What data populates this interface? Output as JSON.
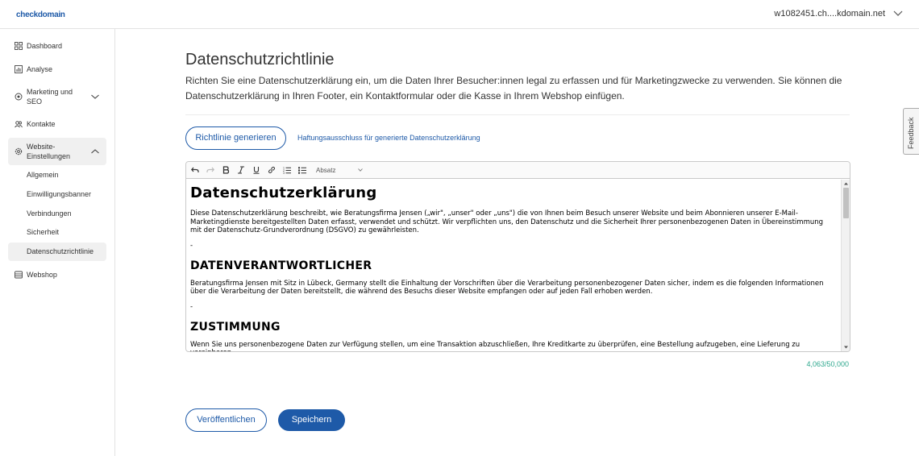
{
  "header": {
    "logo": "checkdomain",
    "account": "w1082451.ch....kdomain.net"
  },
  "sidebar": {
    "items": [
      {
        "label": "Dashboard",
        "icon": "grid-icon"
      },
      {
        "label": "Analyse",
        "icon": "bar-chart-icon"
      },
      {
        "label": "Marketing und SEO",
        "icon": "target-icon"
      },
      {
        "label": "Kontakte",
        "icon": "users-icon"
      },
      {
        "label": "Website-Einstellungen",
        "icon": "gear-icon"
      },
      {
        "label": "Webshop",
        "icon": "store-icon"
      }
    ],
    "marketing_line1": "Marketing und",
    "marketing_line2": "SEO",
    "website_line1": "Website-",
    "website_line2": "Einstellungen",
    "subitems": [
      "Allgemein",
      "Einwilligungsbanner",
      "Verbindungen",
      "Sicherheit",
      "Datenschutzrichtlinie"
    ]
  },
  "main": {
    "title": "Datenschutzrichtlinie",
    "description": "Richten Sie eine Datenschutzerklärung ein, um die Daten Ihrer Besucher:innen legal zu erfassen und für Marketingzwecke zu verwenden. Sie können die Datenschutzerklärung in Ihren Footer, ein Kontaktformular oder die Kasse in Ihrem Webshop einfügen.",
    "generate_button": "Richtlinie generieren",
    "disclaimer_link": "Haftungsausschluss für generierte Datenschutzerklärung",
    "editor": {
      "format_select": "Absatz",
      "heading1": "Datenschutzerklärung",
      "para1": "Diese Datenschutzerklärung beschreibt, wie Beratungsfirma Jensen („wir\", „unser\" oder „uns\") die von Ihnen beim Besuch unserer Website und beim Abonnieren unserer E-Mail-Marketingdienste bereitgestellten Daten erfasst, verwendet und schützt. Wir verpflichten uns, den Datenschutz und die Sicherheit Ihrer personenbezogenen Daten in Übereinstimmung mit der Datenschutz-Grundverordnung (DSGVO) zu gewährleisten.",
      "dash": "-",
      "heading2": "DATENVERANTWORTLICHER",
      "para2": "Beratungsfirma Jensen mit Sitz in Lübeck, Germany stellt die Einhaltung der Vorschriften über die Verarbeitung personenbezogener Daten sicher, indem es die folgenden Informationen über die Verarbeitung der Daten bereitstellt, die während des Besuchs dieser Website empfangen oder auf jeden Fall erhoben werden.",
      "heading3": "ZUSTIMMUNG",
      "para3": "Wenn Sie uns personenbezogene Daten zur Verfügung stellen, um eine Transaktion abzuschließen, Ihre Kreditkarte zu überprüfen, eine Bestellung aufzugeben, eine Lieferung zu vereinbaren"
    },
    "counter": "4,063/50,000",
    "publish_button": "Veröffentlichen",
    "save_button": "Speichern"
  },
  "feedback_tab": "Feedback",
  "colors": {
    "brand": "#1e5aa8",
    "counter": "#2ea88e",
    "active_bg": "#f0f0f0"
  }
}
